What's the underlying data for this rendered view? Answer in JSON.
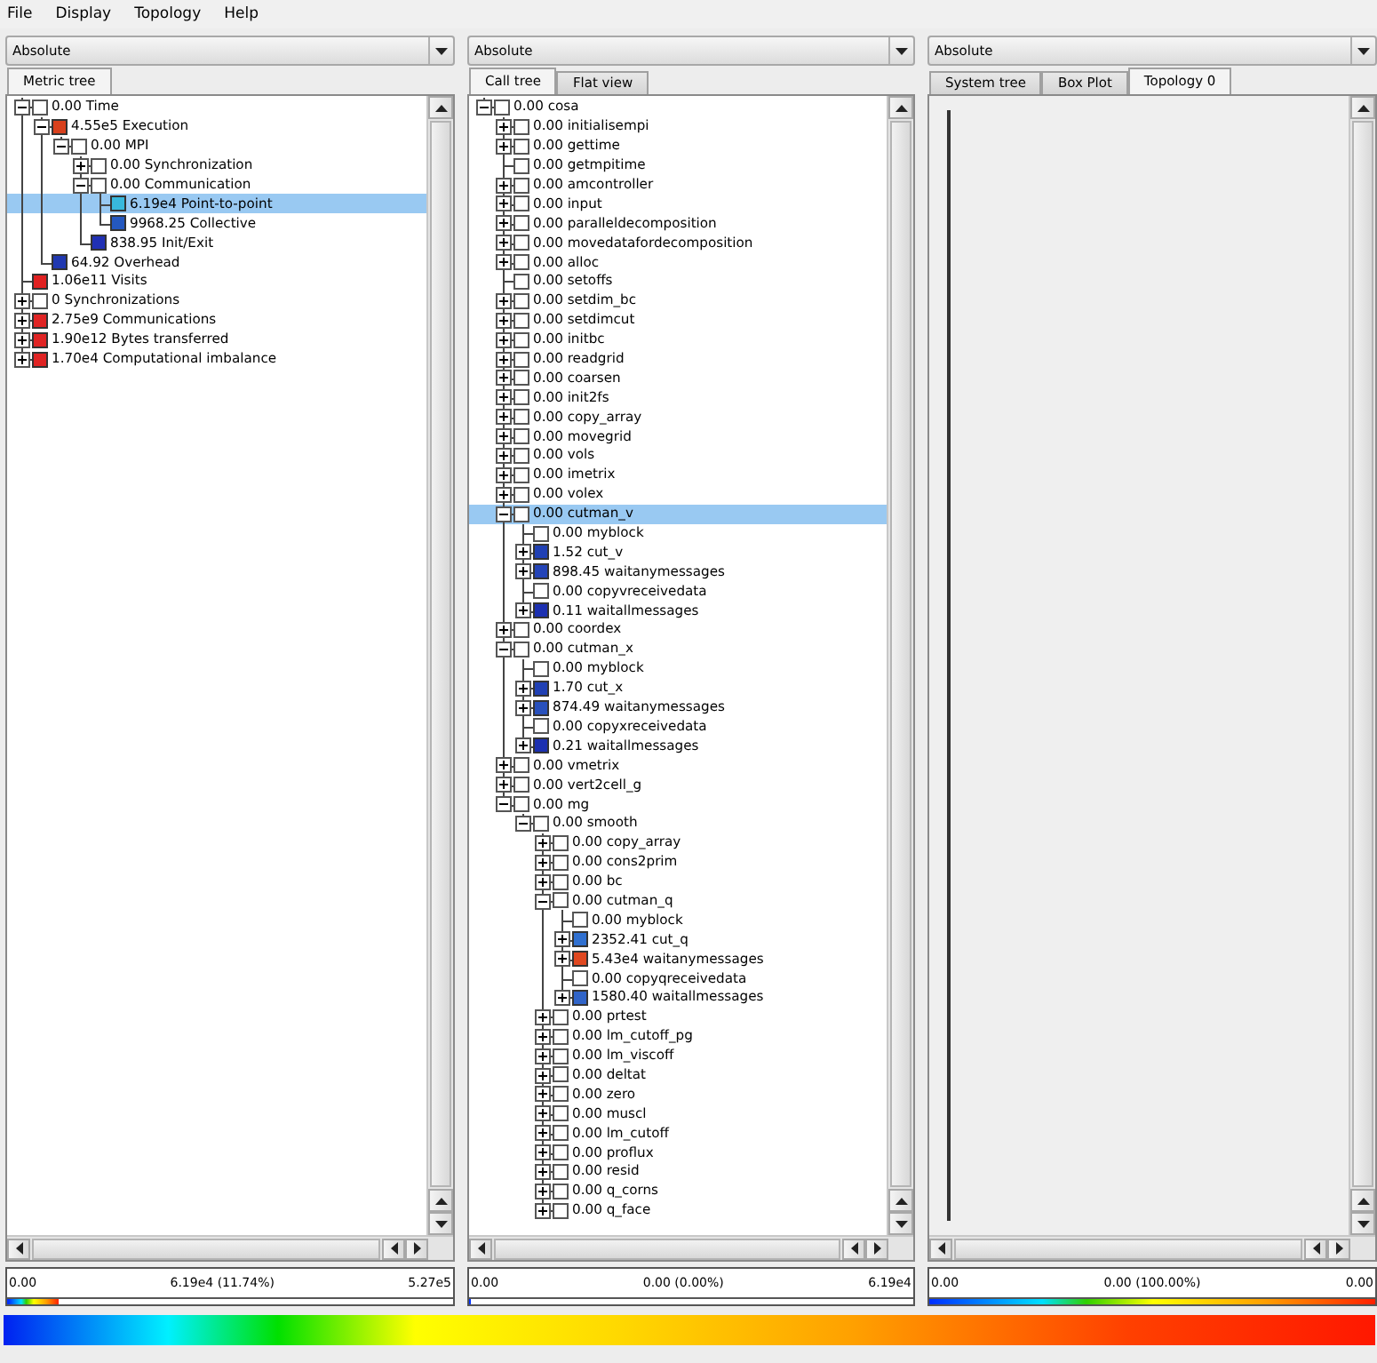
{
  "menu": [
    "File",
    "Display",
    "Topology",
    "Help"
  ],
  "panels": [
    {
      "kind": "tree",
      "dropdown": "Absolute",
      "tabs": [
        {
          "label": "Metric tree",
          "selected": true
        }
      ],
      "tree": [
        {
          "text": "0.00 Time",
          "kind": "branch",
          "expanded": true,
          "selected": false,
          "children": [
            {
              "text": "4.55e5 Execution",
              "kind": "branch",
              "expanded": true,
              "selected": false,
              "color": "#d8401c",
              "children": [
                {
                  "text": "0.00 MPI",
                  "kind": "branch",
                  "expanded": true,
                  "selected": false,
                  "children": [
                    {
                      "text": "0.00 Synchronization",
                      "kind": "branch",
                      "expanded": false,
                      "selected": false
                    },
                    {
                      "text": "0.00 Communication",
                      "kind": "branch",
                      "expanded": true,
                      "selected": false,
                      "children": [
                        {
                          "text": "6.19e4 Point-to-point",
                          "kind": "leaf",
                          "selected": true,
                          "color": "#38b8dc"
                        },
                        {
                          "text": "9968.25 Collective",
                          "kind": "leaf",
                          "selected": false,
                          "color": "#2458c0"
                        }
                      ]
                    },
                    {
                      "text": "838.95 Init/Exit",
                      "kind": "leaf",
                      "selected": false,
                      "color": "#2030b4"
                    }
                  ]
                }
              ]
            },
            {
              "text": "64.92 Overhead",
              "kind": "leaf",
              "selected": false,
              "color": "#2038b0"
            }
          ]
        },
        {
          "text": "1.06e11 Visits",
          "kind": "leaf",
          "selected": false,
          "color": "#e02020"
        },
        {
          "text": "0 Synchronizations",
          "kind": "branch",
          "expanded": false,
          "selected": false
        },
        {
          "text": "2.75e9 Communications",
          "kind": "branch",
          "expanded": false,
          "selected": false,
          "color": "#e02424"
        },
        {
          "text": "1.90e12 Bytes transferred",
          "kind": "branch",
          "expanded": false,
          "selected": false,
          "color": "#e02424"
        },
        {
          "text": "1.70e4 Computational imbalance",
          "kind": "branch",
          "expanded": false,
          "selected": false,
          "color": "#e02424"
        }
      ],
      "value_bar": {
        "min": "0.00",
        "value": "6.19e4 (11.74%)",
        "max": "5.27e5",
        "level": 0.1174
      }
    },
    {
      "kind": "tree",
      "dropdown": "Absolute",
      "tabs": [
        {
          "label": "Call tree",
          "selected": true
        },
        {
          "label": "Flat view",
          "selected": false
        }
      ],
      "tree": [
        {
          "text": "0.00 cosa",
          "kind": "branch",
          "expanded": true,
          "selected": false,
          "children": [
            {
              "text": "0.00 initialisempi",
              "kind": "branch",
              "expanded": false,
              "selected": false
            },
            {
              "text": "0.00 gettime",
              "kind": "branch",
              "expanded": false,
              "selected": false
            },
            {
              "text": "0.00 getmpitime",
              "kind": "leaf",
              "selected": false
            },
            {
              "text": "0.00 amcontroller",
              "kind": "branch",
              "expanded": false,
              "selected": false
            },
            {
              "text": "0.00 input",
              "kind": "branch",
              "expanded": false,
              "selected": false
            },
            {
              "text": "0.00 paralleldecomposition",
              "kind": "branch",
              "expanded": false,
              "selected": false
            },
            {
              "text": "0.00 movedatafordecomposition",
              "kind": "branch",
              "expanded": false,
              "selected": false
            },
            {
              "text": "0.00 alloc",
              "kind": "branch",
              "expanded": false,
              "selected": false
            },
            {
              "text": "0.00 setoffs",
              "kind": "leaf",
              "selected": false
            },
            {
              "text": "0.00 setdim_bc",
              "kind": "branch",
              "expanded": false,
              "selected": false
            },
            {
              "text": "0.00 setdimcut",
              "kind": "branch",
              "expanded": false,
              "selected": false
            },
            {
              "text": "0.00 initbc",
              "kind": "branch",
              "expanded": false,
              "selected": false
            },
            {
              "text": "0.00 readgrid",
              "kind": "branch",
              "expanded": false,
              "selected": false
            },
            {
              "text": "0.00 coarsen",
              "kind": "branch",
              "expanded": false,
              "selected": false
            },
            {
              "text": "0.00 init2fs",
              "kind": "branch",
              "expanded": false,
              "selected": false
            },
            {
              "text": "0.00 copy_array",
              "kind": "branch",
              "expanded": false,
              "selected": false
            },
            {
              "text": "0.00 movegrid",
              "kind": "branch",
              "expanded": false,
              "selected": false
            },
            {
              "text": "0.00 vols",
              "kind": "branch",
              "expanded": false,
              "selected": false
            },
            {
              "text": "0.00 imetrix",
              "kind": "branch",
              "expanded": false,
              "selected": false
            },
            {
              "text": "0.00 volex",
              "kind": "branch",
              "expanded": false,
              "selected": false
            },
            {
              "text": "0.00 cutman_v",
              "kind": "branch",
              "expanded": true,
              "selected": true,
              "children": [
                {
                  "text": "0.00 myblock",
                  "kind": "leaf",
                  "selected": false
                },
                {
                  "text": "1.52 cut_v",
                  "kind": "branch",
                  "expanded": false,
                  "selected": false,
                  "color": "#2040b4"
                },
                {
                  "text": "898.45 waitanymessages",
                  "kind": "branch",
                  "expanded": false,
                  "selected": false,
                  "color": "#2444b8"
                },
                {
                  "text": "0.00 copyvreceivedata",
                  "kind": "leaf",
                  "selected": false
                },
                {
                  "text": "0.11 waitallmessages",
                  "kind": "branch",
                  "expanded": false,
                  "selected": false,
                  "color": "#1c30b0"
                }
              ]
            },
            {
              "text": "0.00 coordex",
              "kind": "branch",
              "expanded": false,
              "selected": false
            },
            {
              "text": "0.00 cutman_x",
              "kind": "branch",
              "expanded": true,
              "selected": false,
              "children": [
                {
                  "text": "0.00 myblock",
                  "kind": "leaf",
                  "selected": false
                },
                {
                  "text": "1.70 cut_x",
                  "kind": "branch",
                  "expanded": false,
                  "selected": false,
                  "color": "#2040b4"
                },
                {
                  "text": "874.49 waitanymessages",
                  "kind": "branch",
                  "expanded": false,
                  "selected": false,
                  "color": "#2850bc"
                },
                {
                  "text": "0.00 copyxreceivedata",
                  "kind": "leaf",
                  "selected": false
                },
                {
                  "text": "0.21 waitallmessages",
                  "kind": "branch",
                  "expanded": false,
                  "selected": false,
                  "color": "#1c30b0"
                }
              ]
            },
            {
              "text": "0.00 vmetrix",
              "kind": "branch",
              "expanded": false,
              "selected": false
            },
            {
              "text": "0.00 vert2cell_g",
              "kind": "branch",
              "expanded": false,
              "selected": false
            },
            {
              "text": "0.00 mg",
              "kind": "branch",
              "expanded": true,
              "selected": false,
              "children": [
                {
                  "text": "0.00 smooth",
                  "kind": "branch",
                  "expanded": true,
                  "selected": false,
                  "children": [
                    {
                      "text": "0.00 copy_array",
                      "kind": "branch",
                      "expanded": false,
                      "selected": false
                    },
                    {
                      "text": "0.00 cons2prim",
                      "kind": "branch",
                      "expanded": false,
                      "selected": false
                    },
                    {
                      "text": "0.00 bc",
                      "kind": "branch",
                      "expanded": false,
                      "selected": false
                    },
                    {
                      "text": "0.00 cutman_q",
                      "kind": "branch",
                      "expanded": true,
                      "selected": false,
                      "children": [
                        {
                          "text": "0.00 myblock",
                          "kind": "leaf",
                          "selected": false
                        },
                        {
                          "text": "2352.41 cut_q",
                          "kind": "branch",
                          "expanded": false,
                          "selected": false,
                          "color": "#3070d0"
                        },
                        {
                          "text": "5.43e4 waitanymessages",
                          "kind": "branch",
                          "expanded": false,
                          "selected": false,
                          "color": "#e04820"
                        },
                        {
                          "text": "0.00 copyqreceivedata",
                          "kind": "leaf",
                          "selected": false
                        },
                        {
                          "text": "1580.40 waitallmessages",
                          "kind": "branch",
                          "expanded": false,
                          "selected": false,
                          "color": "#3064c8"
                        }
                      ]
                    },
                    {
                      "text": "0.00 prtest",
                      "kind": "branch",
                      "expanded": false,
                      "selected": false
                    },
                    {
                      "text": "0.00 lm_cutoff_pg",
                      "kind": "branch",
                      "expanded": false,
                      "selected": false
                    },
                    {
                      "text": "0.00 lm_viscoff",
                      "kind": "branch",
                      "expanded": false,
                      "selected": false
                    },
                    {
                      "text": "0.00 deltat",
                      "kind": "branch",
                      "expanded": false,
                      "selected": false
                    },
                    {
                      "text": "0.00 zero",
                      "kind": "branch",
                      "expanded": false,
                      "selected": false
                    },
                    {
                      "text": "0.00 muscl",
                      "kind": "branch",
                      "expanded": false,
                      "selected": false
                    },
                    {
                      "text": "0.00 lm_cutoff",
                      "kind": "branch",
                      "expanded": false,
                      "selected": false
                    },
                    {
                      "text": "0.00 proflux",
                      "kind": "branch",
                      "expanded": false,
                      "selected": false
                    },
                    {
                      "text": "0.00 resid",
                      "kind": "branch",
                      "expanded": false,
                      "selected": false
                    },
                    {
                      "text": "0.00 q_corns",
                      "kind": "branch",
                      "expanded": false,
                      "selected": false
                    },
                    {
                      "text": "0.00 q_face",
                      "kind": "branch",
                      "expanded": false,
                      "selected": false
                    }
                  ]
                }
              ]
            }
          ]
        }
      ],
      "value_bar": {
        "min": "0.00",
        "value": "0.00 (0.00%)",
        "max": "6.19e4",
        "level": 0
      }
    },
    {
      "kind": "topology",
      "dropdown": "Absolute",
      "tabs": [
        {
          "label": "System tree",
          "selected": false
        },
        {
          "label": "Box Plot",
          "selected": false
        },
        {
          "label": "Topology 0",
          "selected": true
        }
      ],
      "value_bar": {
        "min": "0.00",
        "value": "0.00 (100.00%)",
        "max": "0.00",
        "level": 1
      }
    }
  ]
}
